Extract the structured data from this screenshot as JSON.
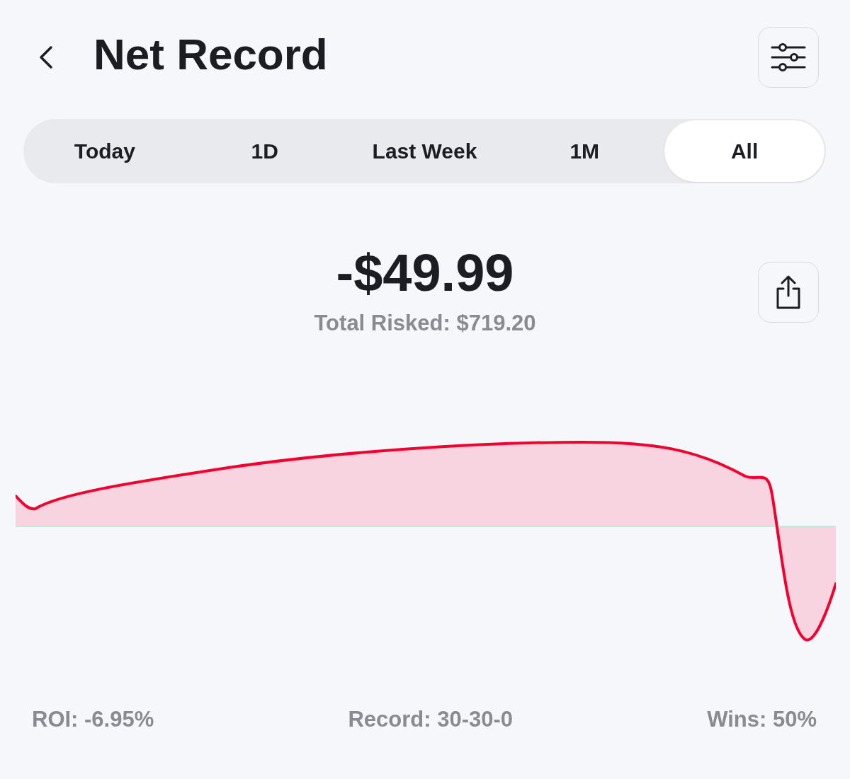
{
  "header": {
    "title": "Net Record"
  },
  "periods": [
    {
      "label": "Today",
      "selected": false
    },
    {
      "label": "1D",
      "selected": false
    },
    {
      "label": "Last Week",
      "selected": false
    },
    {
      "label": "1M",
      "selected": false
    },
    {
      "label": "All",
      "selected": true
    }
  ],
  "summary": {
    "net": "-$49.99",
    "total_risked": "Total Risked: $719.20"
  },
  "stats": [
    "ROI: -6.95%",
    "Record: 30-30-0",
    "Wins: 50%"
  ]
}
